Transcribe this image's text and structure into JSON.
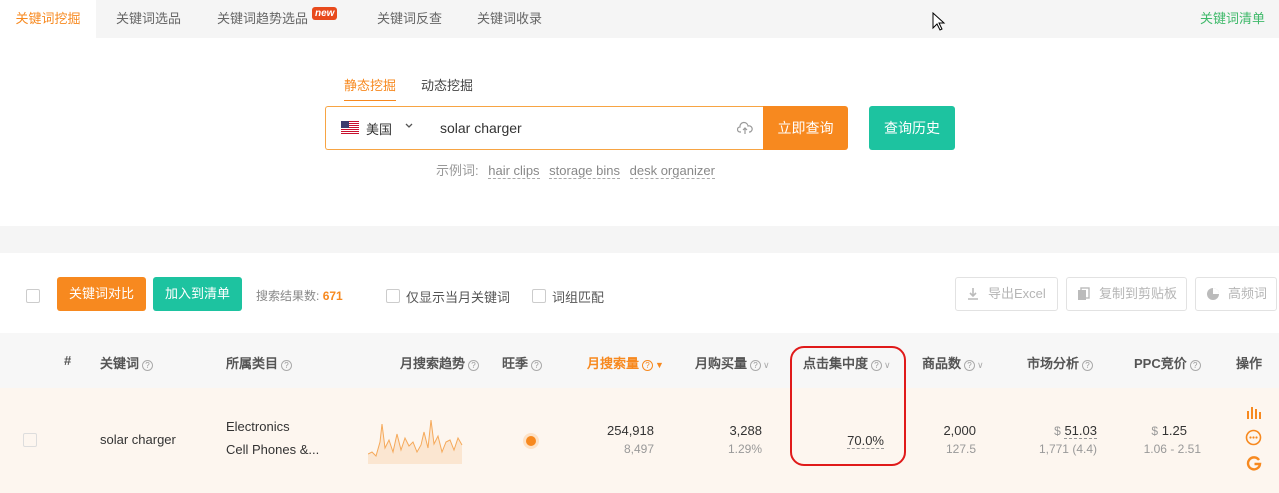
{
  "tabs": [
    {
      "label": "关键词挖掘",
      "active": true
    },
    {
      "label": "关键词选品",
      "active": false
    },
    {
      "label": "关键词趋势选品",
      "active": false,
      "badge": "new"
    },
    {
      "label": "关键词反查",
      "active": false
    },
    {
      "label": "关键词收录",
      "active": false
    }
  ],
  "tab_right": "关键词清单",
  "search": {
    "modes": [
      "静态挖掘",
      "动态挖掘"
    ],
    "active_mode": "静态挖掘",
    "country": "美国",
    "query": "solar charger",
    "submit_label": "立即查询",
    "history_label": "查询历史",
    "examples_label": "示例词:",
    "examples": [
      "hair clips",
      "storage bins",
      "desk organizer"
    ]
  },
  "toolbar": {
    "compare_label": "关键词对比",
    "add_label": "加入到清单",
    "result_count_label": "搜索结果数:",
    "result_count": "671",
    "current_month_label": "仅显示当月关键词",
    "phrase_match_label": "词组匹配",
    "export_label": "导出Excel",
    "copy_label": "复制到剪贴板",
    "frequent_label": "高频词"
  },
  "table": {
    "headers": {
      "index": "#",
      "keyword": "关键词",
      "category": "所属类目",
      "trend": "月搜索趋势",
      "season": "旺季",
      "search_volume": "月搜索量",
      "purchases": "月购买量",
      "click_concentration": "点击集中度",
      "products": "商品数",
      "market": "市场分析",
      "ppc": "PPC竞价",
      "actions": "操作"
    },
    "rows": [
      {
        "keyword": "solar charger",
        "category_1": "Electronics",
        "category_2": "Cell Phones &...",
        "search_volume": "254,918",
        "search_volume_sub": "8,497",
        "purchases": "3,288",
        "purchases_sub": "1.29%",
        "click_concentration": "70.0%",
        "products": "2,000",
        "products_sub": "127.5",
        "market_price_symbol": "$",
        "market_price": "51.03",
        "market_sub": "1,771 (4.4)",
        "ppc_symbol": "$",
        "ppc": "1.25",
        "ppc_range": "1.06 - 2.51"
      }
    ]
  },
  "colors": {
    "accent": "#f7891f",
    "teal": "#1dc3a0",
    "highlight": "#e01a1a"
  }
}
